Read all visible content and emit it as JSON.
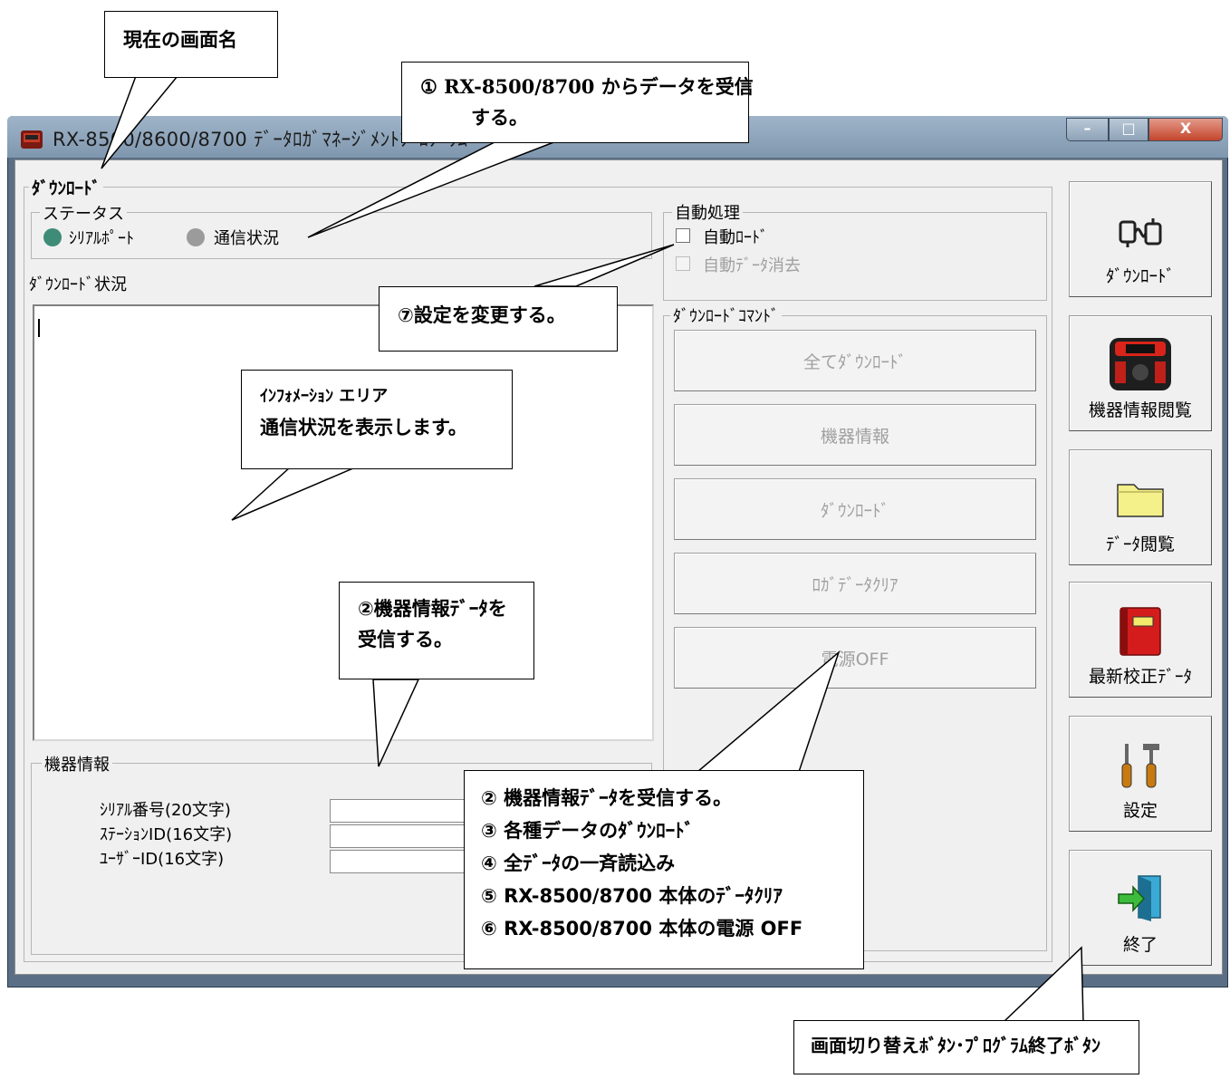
{
  "window": {
    "title": "RX-8500/8600/8700 ﾃﾞｰﾀﾛｶﾞﾏﾈｰｼﾞﾒﾝﾄﾌﾟﾛｸﾞﾗﾑ",
    "min_label": "–",
    "max_label": "□",
    "close_label": "X"
  },
  "screen_title": "ﾀﾞｳﾝﾛｰﾄﾞ",
  "status": {
    "legend": "ステータス",
    "serial_port": "ｼﾘｱﾙﾎﾟｰﾄ",
    "comm_status": "通信状況",
    "serial_color": "#3e8b78",
    "comm_color": "#9b9b9b"
  },
  "download_status_label": "ﾀﾞｳﾝﾛｰﾄﾞ状況",
  "auto": {
    "legend": "自動処理",
    "auto_load": "自動ﾛｰﾄﾞ",
    "auto_delete": "自動ﾃﾞｰﾀ消去"
  },
  "commands": {
    "legend": "ﾀﾞｳﾝﾛｰﾄﾞｺﾏﾝﾄﾞ",
    "buttons": [
      "全てﾀﾞｳﾝﾛｰﾄﾞ",
      "機器情報",
      "ﾀﾞｳﾝﾛｰﾄﾞ",
      "ﾛｶﾞﾃﾞｰﾀｸﾘｱ",
      "電源OFF"
    ]
  },
  "device_info": {
    "legend": "機器情報",
    "serial_label": "ｼﾘｱﾙ番号(20文字)",
    "station_label": "ｽﾃｰｼｮﾝID(16文字)",
    "user_label": "ﾕｰｻﾞｰID(16文字)",
    "serial_value": "",
    "station_value": "",
    "user_value": ""
  },
  "nav": [
    "ﾀﾞｳﾝﾛｰﾄﾞ",
    "機器情報閲覧",
    "ﾃﾞｰﾀ閲覧",
    "最新校正ﾃﾞｰﾀ",
    "設定",
    "終了"
  ],
  "callouts": {
    "screen_name": "現在の画面名",
    "receive_line1": "① RX-8500/8700 からデータを受信",
    "receive_line2": "する。",
    "settings": "⑦設定を変更する。",
    "info_line1": "ｲﾝﾌｫﾒｰｼｮﾝ エリア",
    "info_line2": "通信状況を表示します。",
    "devinfo_line1": "②機器情報ﾃﾞｰﾀを",
    "devinfo_line2": "受信する。",
    "cmd_lines": [
      "② 機器情報ﾃﾞｰﾀを受信する。",
      "③ 各種データのﾀﾞｳﾝﾛｰﾄﾞ",
      "④ 全ﾃﾞｰﾀの一斉読込み",
      "⑤ RX-8500/8700 本体のﾃﾞｰﾀｸﾘｱ",
      "⑥ RX-8500/8700 本体の電源 OFF"
    ],
    "nav_note": "画面切り替えﾎﾞﾀﾝ･ﾌﾟﾛｸﾞﾗﾑ終了ﾎﾞﾀﾝ"
  }
}
